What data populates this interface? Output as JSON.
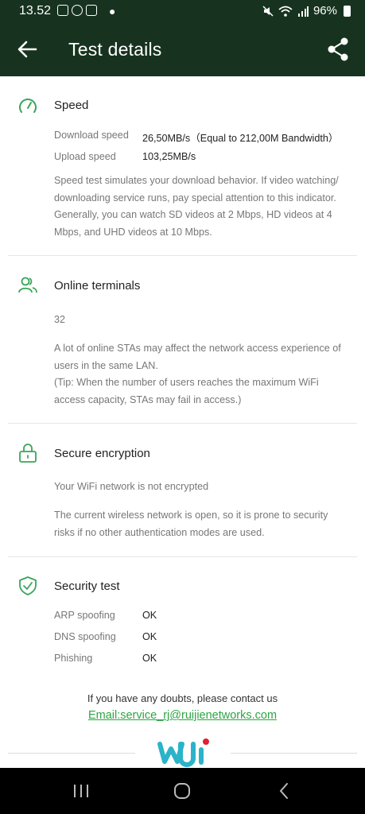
{
  "status_bar": {
    "time": "13.52",
    "battery": "96%"
  },
  "app_bar": {
    "title": "Test details"
  },
  "speed": {
    "title": "Speed",
    "download_label": "Download speed",
    "download_value": "26,50MB/s（Equal to 212,00M Bandwidth）",
    "upload_label": "Upload speed",
    "upload_value": "103,25MB/s",
    "description": [
      "Speed test simulates your download behavior. If video watching/",
      "downloading service runs, pay special attention to this indicator.",
      "Generally, you can watch SD videos at 2 Mbps, HD videos at 4",
      "Mbps, and UHD videos at 10 Mbps."
    ]
  },
  "terminals": {
    "title": "Online terminals",
    "count": "32",
    "description": [
      "A lot of online STAs may affect the network access experience of",
      "users in the same LAN.",
      "(Tip: When the number of users reaches the maximum WiFi",
      "access capacity, STAs may fail in access.)"
    ]
  },
  "encryption": {
    "title": "Secure encryption",
    "status": "Your WiFi network is not encrypted",
    "description": [
      "The current wireless network is open, so it is prone to security",
      "risks if no other authentication modes are used."
    ]
  },
  "security_test": {
    "title": "Security test",
    "rows": [
      {
        "label": "ARP spoofing",
        "value": "OK"
      },
      {
        "label": "DNS spoofing",
        "value": "OK"
      },
      {
        "label": "Phishing",
        "value": "OK"
      }
    ]
  },
  "contact": {
    "text": "If you have any doubts, please contact us",
    "email": "Email:service_rj@ruijienetworks.com"
  },
  "icons": {
    "back": "back-arrow-icon",
    "share": "share-icon",
    "speed": "speedometer-icon",
    "terminals": "users-icon",
    "encryption": "lock-icon",
    "security": "shield-check-icon"
  },
  "colors": {
    "header_bg": "#17331f",
    "accent": "#2aa640",
    "section_icon": "#3aa55a"
  }
}
